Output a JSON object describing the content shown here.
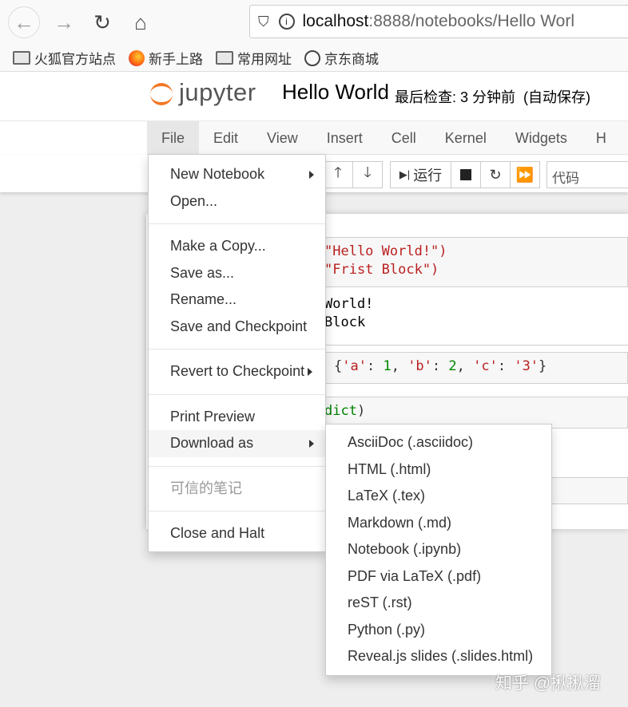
{
  "browser": {
    "url_host": "localhost",
    "url_path": ":8888/notebooks/Hello Worl",
    "bookmarks": [
      "火狐官方站点",
      "新手上路",
      "常用网址",
      "京东商城"
    ]
  },
  "jupyter": {
    "logo_text": "jupyter",
    "notebook_title": "Hello World",
    "checkpoint": "最后检查: 3 分钟前",
    "autosave": "(自动保存)"
  },
  "menubar": [
    "File",
    "Edit",
    "View",
    "Insert",
    "Cell",
    "Kernel",
    "Widgets",
    "H"
  ],
  "toolbar": {
    "run_label": "运行",
    "cell_type": "代码"
  },
  "cells": {
    "c1_line1": "\"Hello World!\")",
    "c1_line2": "\"Frist Block\")",
    "o1_line1": "World!",
    "o1_line2": "Block",
    "c2_open": "{",
    "c2_a": "'a'",
    "c2_1": "1",
    "c2_b": "'b'",
    "c2_2": "2",
    "c2_c": "'c'",
    "c2_3": "'3'",
    "c2_close": "}",
    "c3_dict": "dict",
    "c3_paren": ")"
  },
  "file_menu": {
    "new_notebook": "New Notebook",
    "open": "Open...",
    "make_copy": "Make a Copy...",
    "save_as": "Save as...",
    "rename": "Rename...",
    "save_checkpoint": "Save and Checkpoint",
    "revert": "Revert to Checkpoint",
    "print_preview": "Print Preview",
    "download_as": "Download as",
    "trusted": "可信的笔记",
    "close_halt": "Close and Halt"
  },
  "download_menu": [
    "AsciiDoc (.asciidoc)",
    "HTML (.html)",
    "LaTeX (.tex)",
    "Markdown (.md)",
    "Notebook (.ipynb)",
    "PDF via LaTeX (.pdf)",
    "reST (.rst)",
    "Python (.py)",
    "Reveal.js slides (.slides.html)"
  ],
  "watermark": "知乎 @揪揪溜"
}
